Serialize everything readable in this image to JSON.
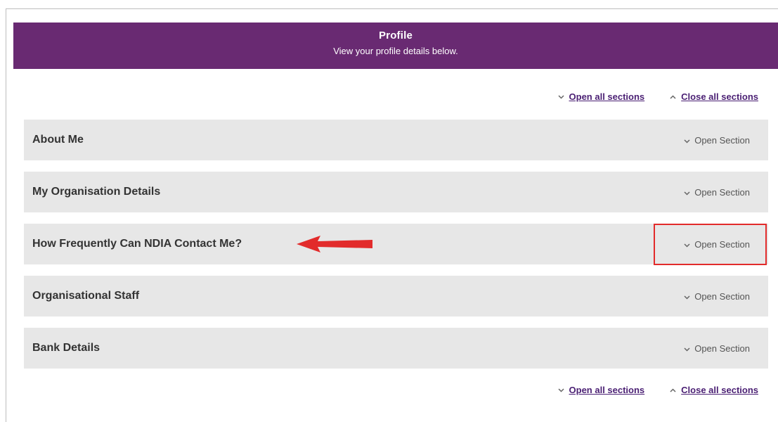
{
  "profile": {
    "title": "Profile",
    "subtitle": "View your profile details below."
  },
  "controls": {
    "open_all": "Open all sections",
    "close_all": "Close all sections"
  },
  "sections": [
    {
      "title": "About Me",
      "toggle": "Open Section"
    },
    {
      "title": "My Organisation Details",
      "toggle": "Open Section"
    },
    {
      "title": "How Frequently Can NDIA Contact Me?",
      "toggle": "Open Section"
    },
    {
      "title": "Organisational Staff",
      "toggle": "Open Section"
    },
    {
      "title": "Bank Details",
      "toggle": "Open Section"
    }
  ],
  "icons": {
    "open": "chevron-down-icon",
    "close": "chevron-up-icon",
    "annotation": "arrow-left-icon"
  },
  "colors": {
    "banner": "#692a72",
    "link": "#4a1f73",
    "section_bg": "#e7e7e7",
    "annotation": "#e22b2b"
  }
}
